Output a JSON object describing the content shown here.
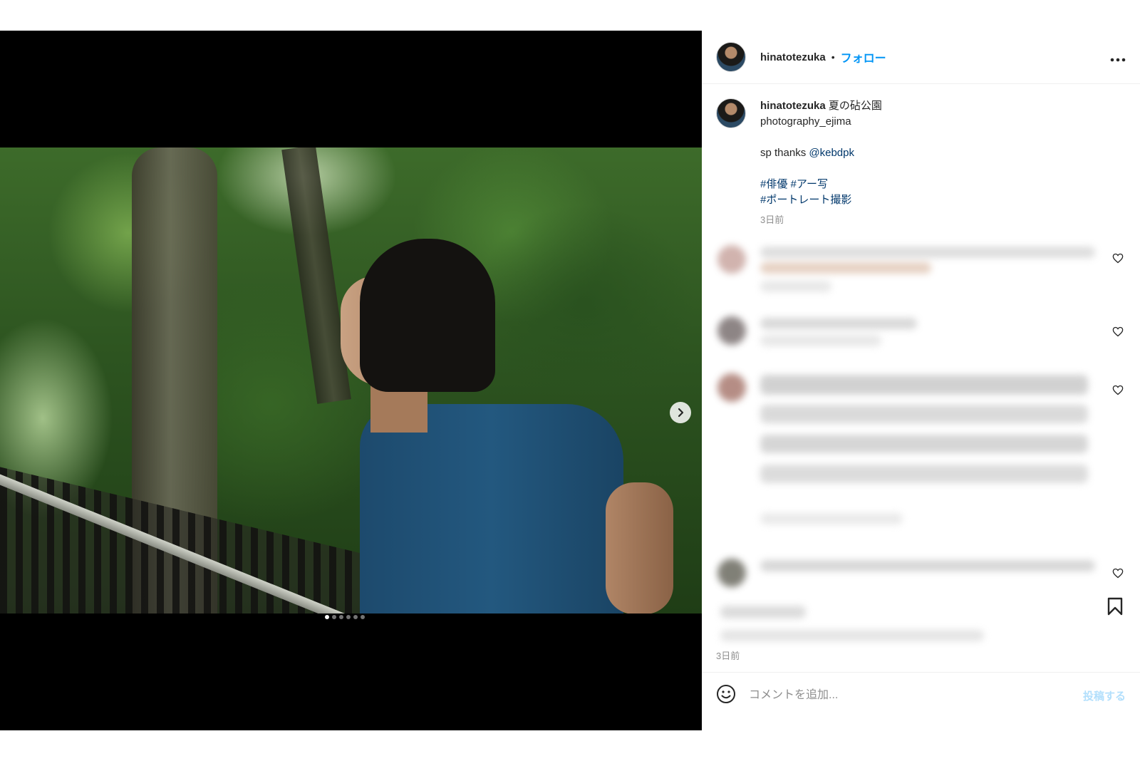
{
  "post": {
    "username": "hinatotezuka",
    "separator": "•",
    "follow_label": "フォロー",
    "more_label": "•••"
  },
  "caption": {
    "username": "hinatotezuka",
    "title": "夏の砧公園",
    "line1": "photography_ejima",
    "thanks_prefix": "sp thanks ",
    "thanks_mention": "@kebdpk",
    "hashtag1": "#俳優",
    "hashtag2": "#アー写",
    "hashtag3": "#ポートレート撮影",
    "time": "3日前"
  },
  "carousel": {
    "slides": 6,
    "active": 1
  },
  "footer": {
    "time": "3日前",
    "comment_placeholder": "コメントを追加...",
    "post_button": "投稿する"
  },
  "icons": [
    "chevron-right-icon",
    "ellipsis-icon",
    "heart-icon",
    "bookmark-icon",
    "emoji-icon"
  ]
}
